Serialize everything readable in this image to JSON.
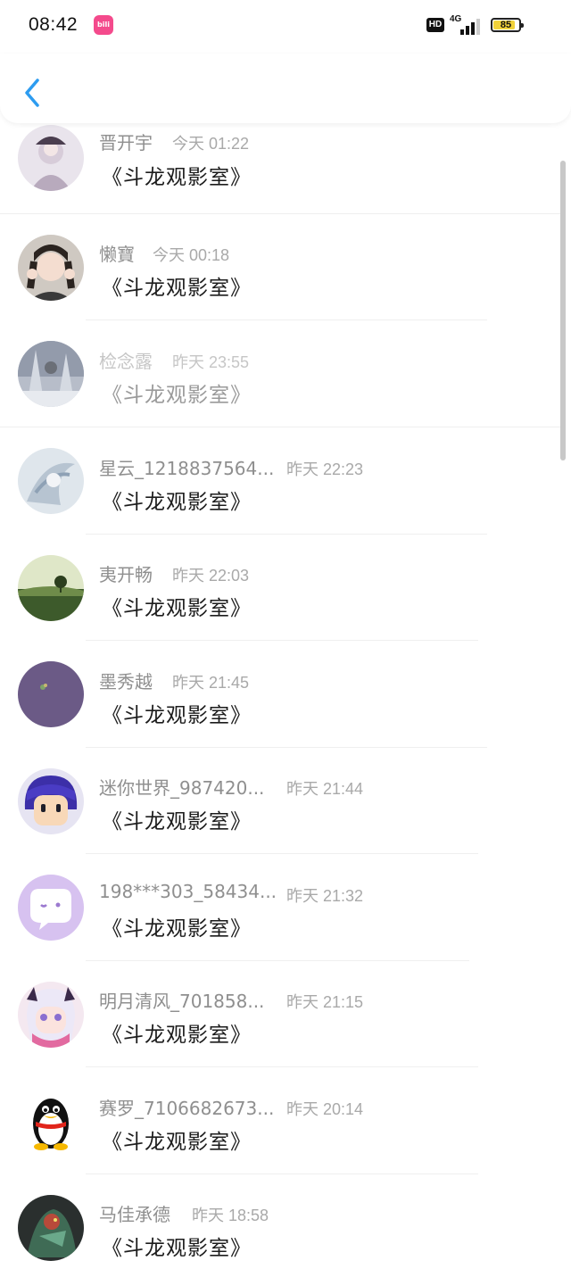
{
  "status_bar": {
    "time": "08:42",
    "app_icon_label": "bili",
    "hd_label": "HD",
    "network": "4G",
    "battery": "85",
    "battery_level": 0.85
  },
  "header": {
    "back_icon": "chevron-left-icon",
    "accent_color": "#2d9cf0"
  },
  "messages": [
    {
      "name": "晋开宇",
      "time": "今天 01:22",
      "text": "《斗龙观影室》"
    },
    {
      "name": "懒寶",
      "time": "今天 00:18",
      "text": "《斗龙观影室》"
    },
    {
      "name": "检念露",
      "time": "昨天 23:55",
      "text": "《斗龙观影室》"
    },
    {
      "name": "星云_1218837564...",
      "time": "昨天 22:23",
      "text": "《斗龙观影室》"
    },
    {
      "name": "夷开畅",
      "time": "昨天 22:03",
      "text": "《斗龙观影室》"
    },
    {
      "name": "墨秀越",
      "time": "昨天 21:45",
      "text": "《斗龙观影室》"
    },
    {
      "name": "迷你世界_987420...",
      "time": "昨天 21:44",
      "text": "《斗龙观影室》"
    },
    {
      "name": "198***303_58434...",
      "time": "昨天 21:32",
      "text": "《斗龙观影室》"
    },
    {
      "name": "明月清风_701858...",
      "time": "昨天 21:15",
      "text": "《斗龙观影室》"
    },
    {
      "name": "赛罗_7106682673...",
      "time": "昨天 20:14",
      "text": "《斗龙观影室》"
    },
    {
      "name": "马佳承德",
      "time": "昨天 18:58",
      "text": "《斗龙观影室》"
    }
  ]
}
